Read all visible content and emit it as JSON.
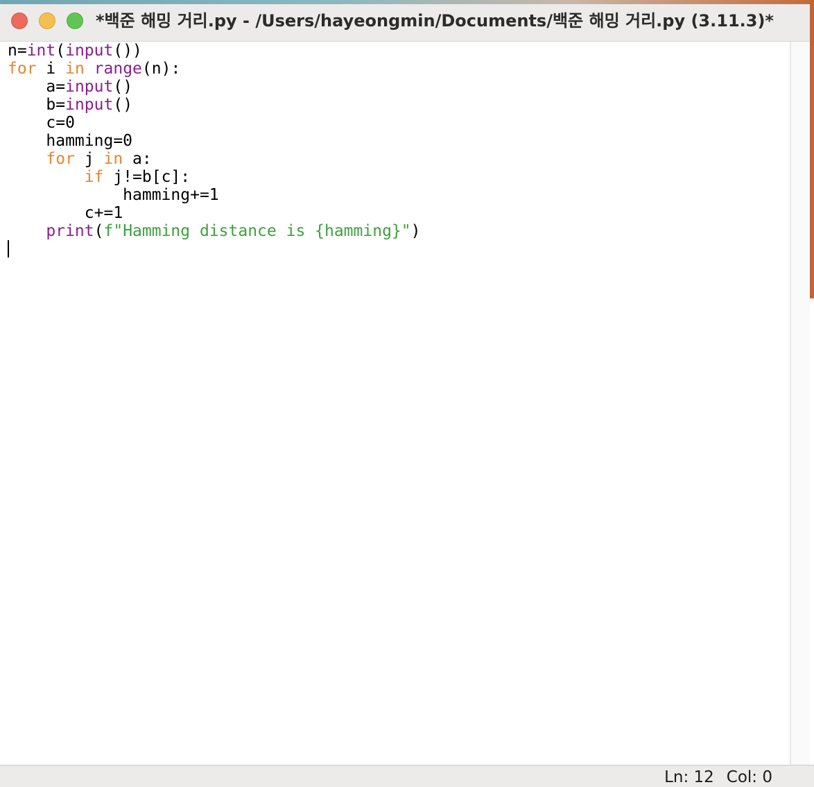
{
  "window": {
    "title": "*백준 해밍 거리.py - /Users/hayeongmin/Documents/백준 해밍 거리.py (3.11.3)*"
  },
  "editor": {
    "lines": [
      [
        {
          "t": "n=",
          "c": "pl"
        },
        {
          "t": "int",
          "c": "bi"
        },
        {
          "t": "(",
          "c": "pl"
        },
        {
          "t": "input",
          "c": "bi"
        },
        {
          "t": "())",
          "c": "pl"
        }
      ],
      [
        {
          "t": "for",
          "c": "kw"
        },
        {
          "t": " i ",
          "c": "pl"
        },
        {
          "t": "in",
          "c": "kw"
        },
        {
          "t": " ",
          "c": "pl"
        },
        {
          "t": "range",
          "c": "bi"
        },
        {
          "t": "(n):",
          "c": "pl"
        }
      ],
      [
        {
          "t": "    a=",
          "c": "pl"
        },
        {
          "t": "input",
          "c": "bi"
        },
        {
          "t": "()",
          "c": "pl"
        }
      ],
      [
        {
          "t": "    b=",
          "c": "pl"
        },
        {
          "t": "input",
          "c": "bi"
        },
        {
          "t": "()",
          "c": "pl"
        }
      ],
      [
        {
          "t": "    c=0",
          "c": "pl"
        }
      ],
      [
        {
          "t": "    hamming=0",
          "c": "pl"
        }
      ],
      [
        {
          "t": "    ",
          "c": "pl"
        },
        {
          "t": "for",
          "c": "kw"
        },
        {
          "t": " j ",
          "c": "pl"
        },
        {
          "t": "in",
          "c": "kw"
        },
        {
          "t": " a:",
          "c": "pl"
        }
      ],
      [
        {
          "t": "        ",
          "c": "pl"
        },
        {
          "t": "if",
          "c": "kw"
        },
        {
          "t": " j!=b[c]:",
          "c": "pl"
        }
      ],
      [
        {
          "t": "            hamming+=1",
          "c": "pl"
        }
      ],
      [
        {
          "t": "        c+=1",
          "c": "pl"
        }
      ],
      [
        {
          "t": "    ",
          "c": "pl"
        },
        {
          "t": "print",
          "c": "bi"
        },
        {
          "t": "(",
          "c": "pl"
        },
        {
          "t": "f\"Hamming distance is {hamming}\"",
          "c": "str"
        },
        {
          "t": ")",
          "c": "pl"
        }
      ]
    ]
  },
  "status": {
    "line": "Ln: 12",
    "col": "Col: 0"
  },
  "colors": {
    "keyword": "#e58630",
    "builtin": "#8a1f8f",
    "string": "#3ca23c",
    "plain": "#000000"
  }
}
